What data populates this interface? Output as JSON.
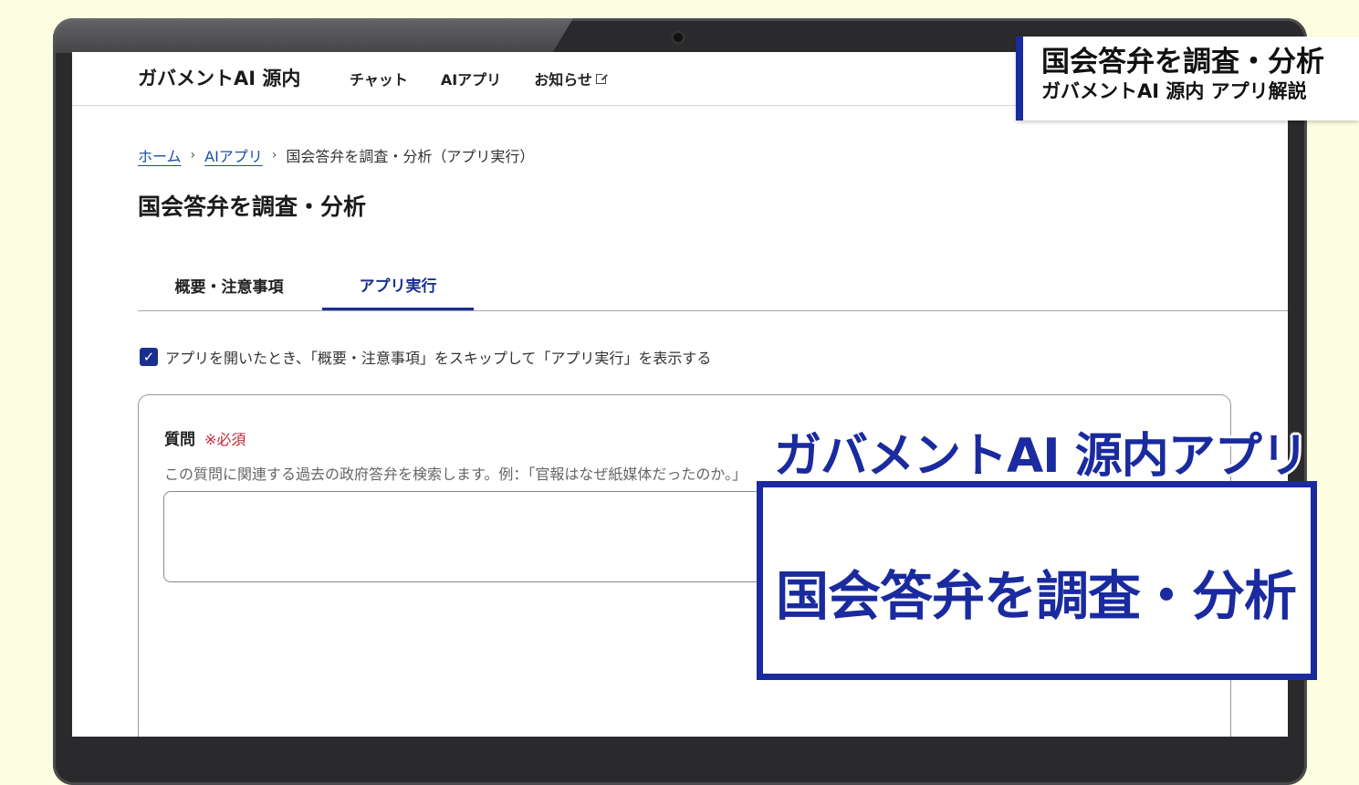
{
  "app": {
    "logo": "ガバメントAI 源内",
    "nav": [
      {
        "label": "チャット"
      },
      {
        "label": "AIアプリ"
      },
      {
        "label": "お知らせ",
        "icon": "external-link-icon"
      }
    ]
  },
  "breadcrumb": {
    "home": "ホーム",
    "sep": "›",
    "apps": "AIアプリ",
    "current": "国会答弁を調査・分析（アプリ実行）"
  },
  "page": {
    "title": "国会答弁を調査・分析"
  },
  "tabs": [
    {
      "label": "概要・注意事項",
      "active": false
    },
    {
      "label": "アプリ実行",
      "active": true
    }
  ],
  "skip_option": {
    "checked": true,
    "check_glyph": "✓",
    "label": "アプリを開いたとき、「概要・注意事項」をスキップして「アプリ実行」を表示する"
  },
  "form": {
    "question_label": "質問",
    "required_mark": "※必須",
    "help_text": "この質問に関連する過去の政府答弁を検索します。例：「官報はなぜ紙媒体だったのか。」",
    "input_value": ""
  },
  "overlay": {
    "corner_title": "国会答弁を調査・分析",
    "corner_subtitle": "ガバメントAI 源内 アプリ解説",
    "caption_title": "ガバメントAI 源内アプリ",
    "caption_box_text": "国会答弁を調査・分析"
  },
  "colors": {
    "accent": "#1a2f8f",
    "required": "#c0263a",
    "background": "#fdfde2"
  }
}
